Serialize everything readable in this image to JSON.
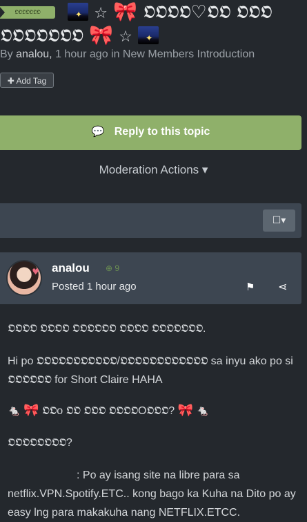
{
  "topic": {
    "badge": "𝕺𝕺𝕺𝕺𝕺𝕺𝕺",
    "title_line1": "𝕺𝕺𝕺𝕺♡𝕺𝕺 𝕺𝕺𝕺",
    "title_line2": "𝕺𝕺𝕺𝕺𝕺𝕺𝕺",
    "byline_prefix": "By",
    "author": "analou,",
    "byline_suffix": "1 hour ago in New Members Introduction",
    "add_tag_label": "Add Tag"
  },
  "actions": {
    "reply_label": "Reply to this topic",
    "moderation_label": "Moderation Actions"
  },
  "post": {
    "author": "analou",
    "reputation": "9",
    "posted": "Posted 1 hour ago",
    "body": {
      "line1": "𝕺𝕺𝕺𝕺 𝕺𝕺𝕺𝕺 𝕺𝕺𝕺𝕺𝕺𝕺 𝕺𝕺𝕺𝕺 𝕺𝕺𝕺𝕺𝕺𝕺𝕺.",
      "line2": "Hi po 𝕺𝕺𝕺𝕺𝕺𝕺𝕺𝕺𝕺𝕺𝕺/𝕺𝕺𝕺𝕺𝕺𝕺𝕺𝕺𝕺𝕺𝕺𝕺 sa inyu ako po si 𝕺𝕺𝕺𝕺𝕺𝕺 for Short Claire HAHA",
      "line3": "𝕺𝕺o 𝕺𝕺 𝕺𝕺𝕺 𝕺𝕺𝕺𝕺O𝕺𝕺𝕺?",
      "line4": "𝕺𝕺𝕺𝕺𝕺𝕺𝕺𝕺?",
      "line5": ": Po ay isang site na libre para sa netflix.VPN.Spotify.ETC.. kong bago ka Kuha na Dito po ay easy lng para makakuha nang NETFLIX.ETCC."
    }
  },
  "colors": {
    "background": "#24282d",
    "accent_green": "#8fb06a",
    "bar": "#3d4651"
  }
}
